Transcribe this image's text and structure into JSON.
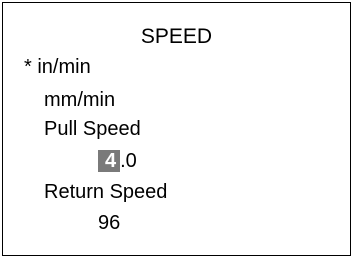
{
  "screen": {
    "title": "SPEED",
    "options": [
      {
        "label": "in/min",
        "marker": "* "
      },
      {
        "label": "mm/min",
        "marker": ""
      }
    ],
    "pull_speed": {
      "label": "Pull Speed",
      "value_cursor_digit": "4",
      "value_rest": ".0"
    },
    "return_speed": {
      "label": "Return Speed",
      "value": "96"
    },
    "colors": {
      "cursor_background": "#7a7a7a",
      "cursor_text": "#ffffff"
    }
  }
}
